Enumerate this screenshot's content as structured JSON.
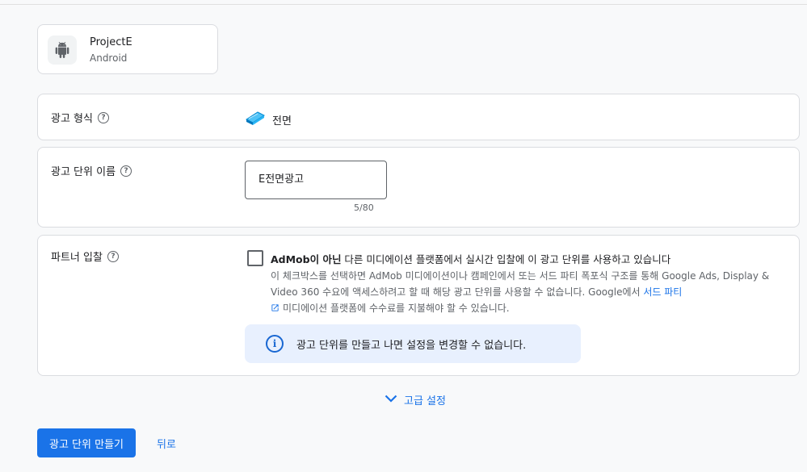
{
  "app": {
    "name": "ProjectE",
    "platform": "Android",
    "icon": "android-icon"
  },
  "ad_format": {
    "label": "광고 형식",
    "value": "전면",
    "icon": "interstitial-icon"
  },
  "ad_unit_name": {
    "label": "광고 단위 이름",
    "value": "E전면광고",
    "counter": "5/80"
  },
  "partner_bidding": {
    "label": "파트너 입찰",
    "checkbox_bold": "AdMob이 아닌",
    "checkbox_text": " 다른 미디에이션 플랫폼에서 실시간 입찰에 이 광고 단위를 사용하고 있습니다",
    "description_prefix": "이 체크박스를 선택하면 AdMob 미디에이션이나 캠페인에서 또는 서드 파티 폭포식 구조를 통해 Google Ads, Display & Video 360 수요에 액세스하려고 할 때 해당 광고 단위를 사용할 수 없습니다. Google에서 ",
    "description_link": "서드 파티",
    "description_suffix": "미디에이션 플랫폼에 수수료를 지불해야 할 수 있습니다.",
    "checked": false
  },
  "info_message": "광고 단위를 만들고 나면 설정을 변경할 수 없습니다.",
  "advanced_settings": "고급 설정",
  "buttons": {
    "create": "광고 단위 만들기",
    "back": "뒤로"
  },
  "colors": {
    "primary": "#1a73e8",
    "info_bg": "#e8f0fe"
  }
}
